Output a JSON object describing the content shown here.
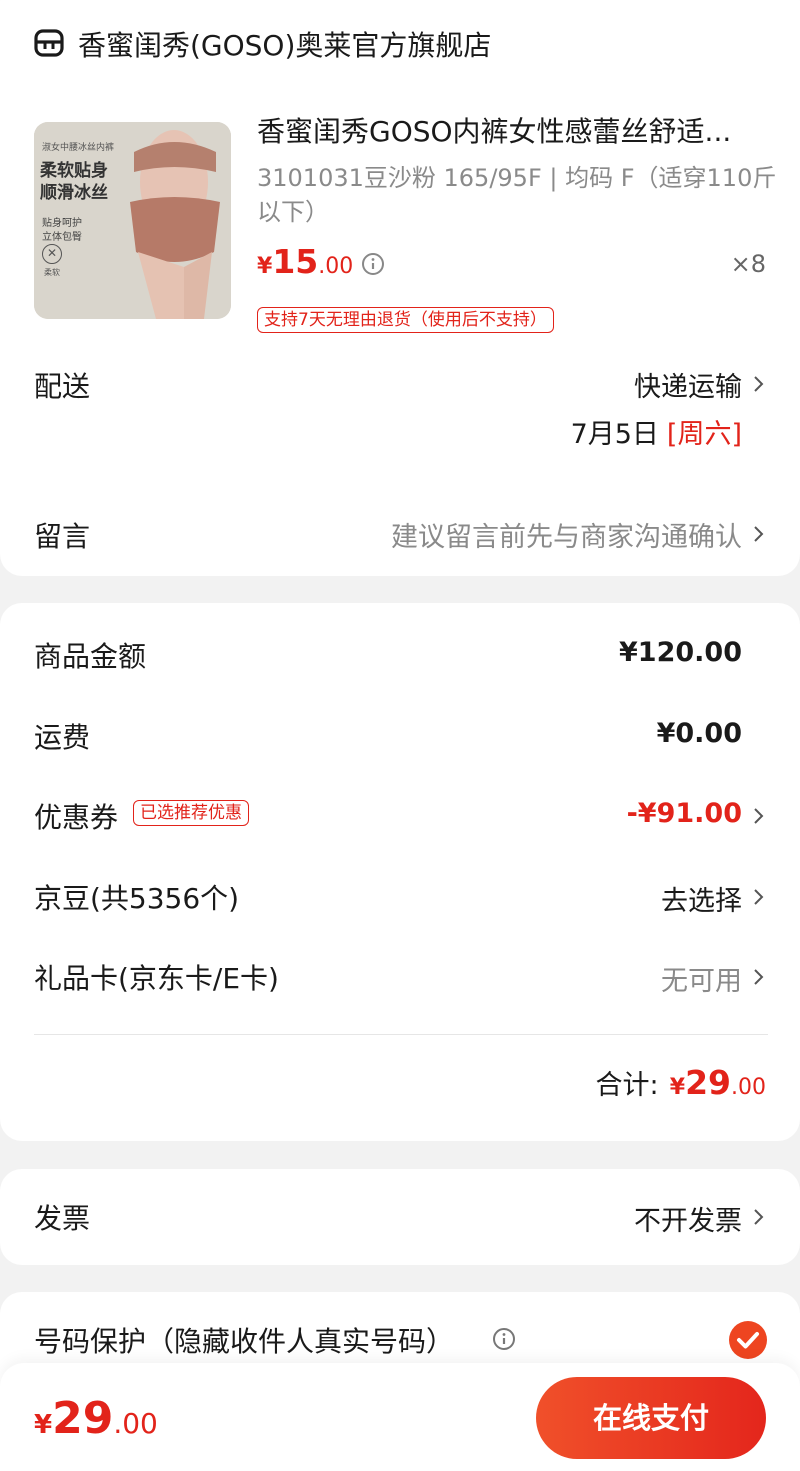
{
  "store": {
    "name": "香蜜闺秀(GOSO)奥莱官方旗舰店",
    "icon": "store-icon"
  },
  "product": {
    "thumb_text": {
      "top": "淑女中腰冰丝内裤",
      "main1": "柔软贴身",
      "main2": "顺滑冰丝",
      "sub1": "贴身呵护",
      "sub2": "立体包臀",
      "badge": "柔软"
    },
    "title": "香蜜闺秀GOSO内裤女性感蕾丝舒适...",
    "spec_line1": "3101031豆沙粉 165/95F | 均码 F（适穿110斤",
    "spec_line2": "以下）",
    "price_symbol": "¥",
    "price_int": "15",
    "price_dec": ".00",
    "quantity": "×8",
    "return_tag": "支持7天无理由退货（使用后不支持）"
  },
  "delivery": {
    "label": "配送",
    "method": "快递运输",
    "date": "7月5日",
    "weekday": "[周六]"
  },
  "message": {
    "label": "留言",
    "placeholder": "建议留言前先与商家沟通确认"
  },
  "summary": {
    "goods_label": "商品金额",
    "goods_value": "¥120.00",
    "shipping_label": "运费",
    "shipping_value": "¥0.00",
    "coupon_label": "优惠券",
    "coupon_tag": "已选推荐优惠",
    "coupon_value": "-¥91.00",
    "beans_label": "京豆(共5356个)",
    "beans_value": "去选择",
    "giftcard_label": "礼品卡(京东卡/E卡)",
    "giftcard_value": "无可用",
    "total_label": "合计:",
    "total_symbol": "¥",
    "total_int": "29",
    "total_dec": ".00"
  },
  "invoice": {
    "label": "发票",
    "value": "不开发票"
  },
  "privacy": {
    "label": "号码保护（隐藏收件人真实号码）",
    "checked": true
  },
  "bottom": {
    "symbol": "¥",
    "int": "29",
    "dec": ".00",
    "pay_label": "在线支付"
  },
  "colors": {
    "accent": "#e2231a",
    "pay_start": "#f0502a",
    "pay_end": "#e4261c"
  }
}
